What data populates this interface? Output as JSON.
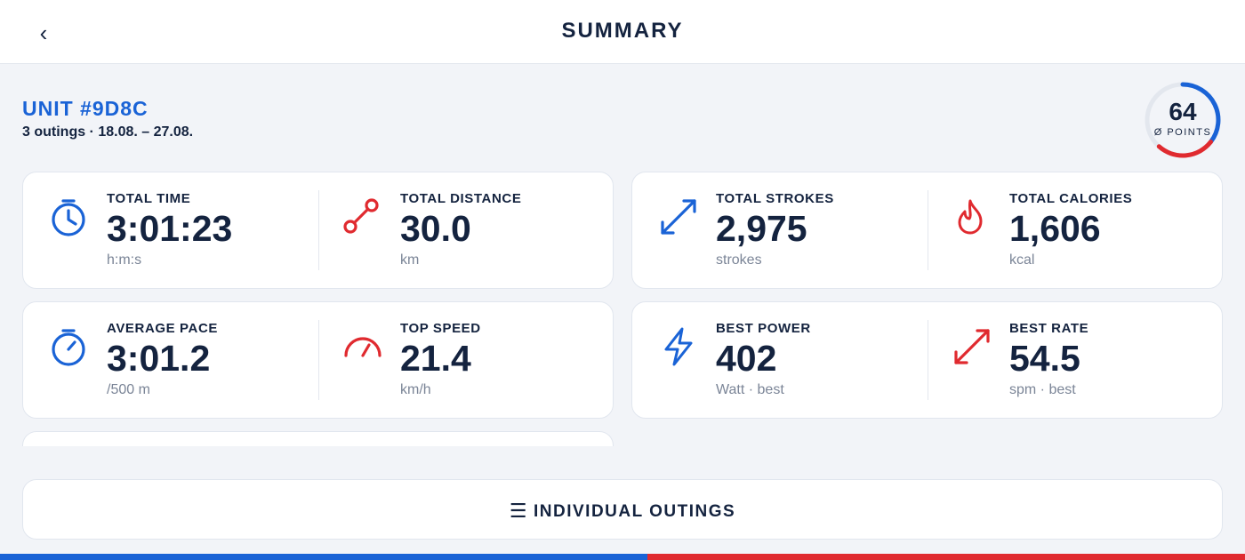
{
  "header": {
    "title": "SUMMARY",
    "back_icon": "‹"
  },
  "unit": {
    "title": "UNIT #9D8C",
    "subtitle": "3 outings · 18.08. – 27.08."
  },
  "points": {
    "value": "64",
    "label": "Ø POINTS",
    "fraction": 0.64,
    "color_primary": "#1a63d6",
    "color_secondary": "#e02a2f"
  },
  "stats": {
    "total_time": {
      "label": "TOTAL TIME",
      "value": "3:01:23",
      "unit": "h:m:s",
      "icon": "stopwatch-icon"
    },
    "total_distance": {
      "label": "TOTAL DISTANCE",
      "value": "30.0",
      "unit": "km",
      "icon": "route-icon"
    },
    "total_strokes": {
      "label": "TOTAL STROKES",
      "value": "2,975",
      "unit": "strokes",
      "icon": "diagonal-arrow-icon"
    },
    "total_calories": {
      "label": "TOTAL CALORIES",
      "value": "1,606",
      "unit": "kcal",
      "icon": "flame-icon"
    },
    "average_pace": {
      "label": "AVERAGE PACE",
      "value": "3:01.2",
      "unit": "/500 m",
      "icon": "timer-icon"
    },
    "top_speed": {
      "label": "TOP SPEED",
      "value": "21.4",
      "unit": "km/h",
      "icon": "speedometer-icon"
    },
    "best_power": {
      "label": "BEST POWER",
      "value": "402",
      "unit": "Watt · best",
      "icon": "lightning-icon"
    },
    "best_rate": {
      "label": "BEST RATE",
      "value": "54.5",
      "unit": "spm · best",
      "icon": "diagonal-arrow-icon"
    }
  },
  "outings_button": {
    "label": "INDIVIDUAL OUTINGS",
    "icon": "☰"
  },
  "colors": {
    "accent_blue": "#1a63d6",
    "accent_red": "#e02a2f",
    "text_dark": "#14233f"
  }
}
